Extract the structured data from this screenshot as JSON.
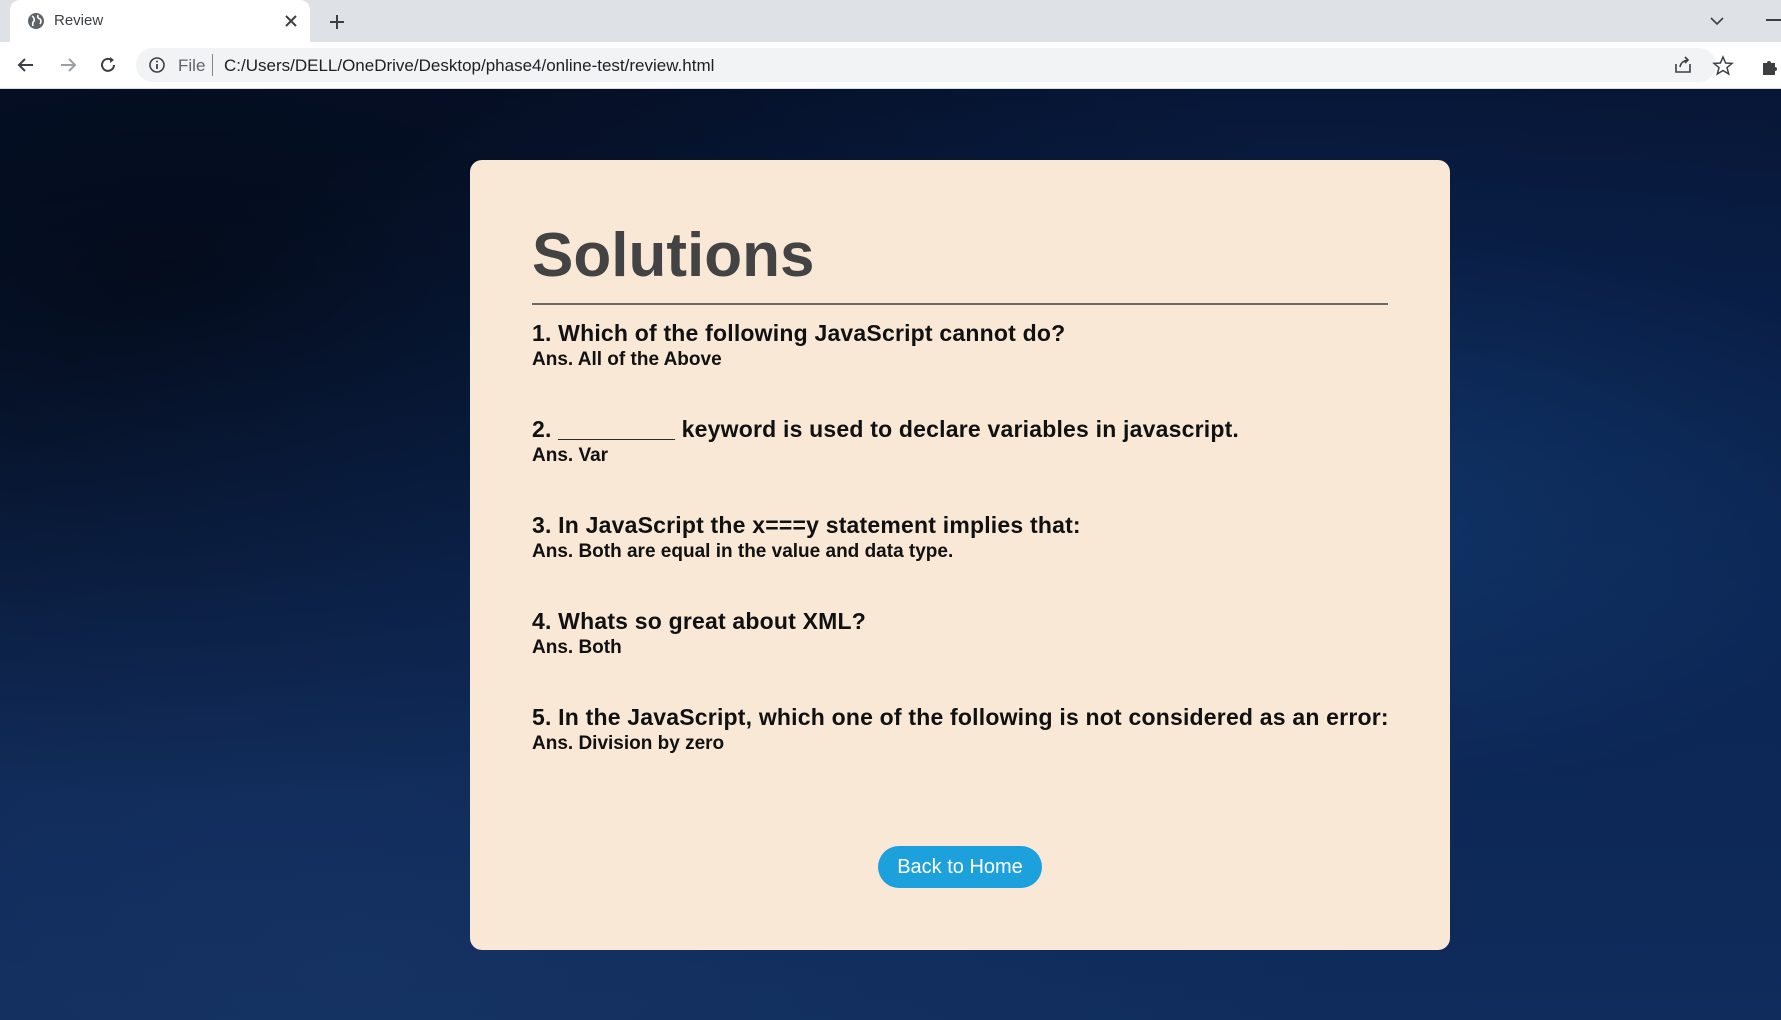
{
  "browser": {
    "tab_title": "Review",
    "scheme_label": "File",
    "url": "C:/Users/DELL/OneDrive/Desktop/phase4/online-test/review.html"
  },
  "page": {
    "heading": "Solutions",
    "items": [
      {
        "question": "1. Which of the following JavaScript cannot do?",
        "answer": "Ans. All of the Above"
      },
      {
        "question": "2. _________ keyword is used to declare variables in javascript.",
        "answer": "Ans. Var"
      },
      {
        "question": "3. In JavaScript the x===y statement implies that:",
        "answer": "Ans. Both are equal in the value and data type."
      },
      {
        "question": "4. Whats so great about XML?",
        "answer": "Ans. Both"
      },
      {
        "question": "5. In the JavaScript, which one of the following is not considered as an error:",
        "answer": "Ans. Division by zero"
      }
    ],
    "home_button": "Back to Home"
  },
  "colors": {
    "card_background": "#f9e8d6",
    "button_background": "#1da1dc",
    "page_background": "#0b1a3a"
  },
  "icons": [
    "globe-icon",
    "close-icon",
    "plus-icon",
    "chevron-down-icon",
    "back-arrow-icon",
    "forward-arrow-icon",
    "reload-icon",
    "info-icon",
    "share-icon",
    "star-icon",
    "extensions-icon"
  ]
}
